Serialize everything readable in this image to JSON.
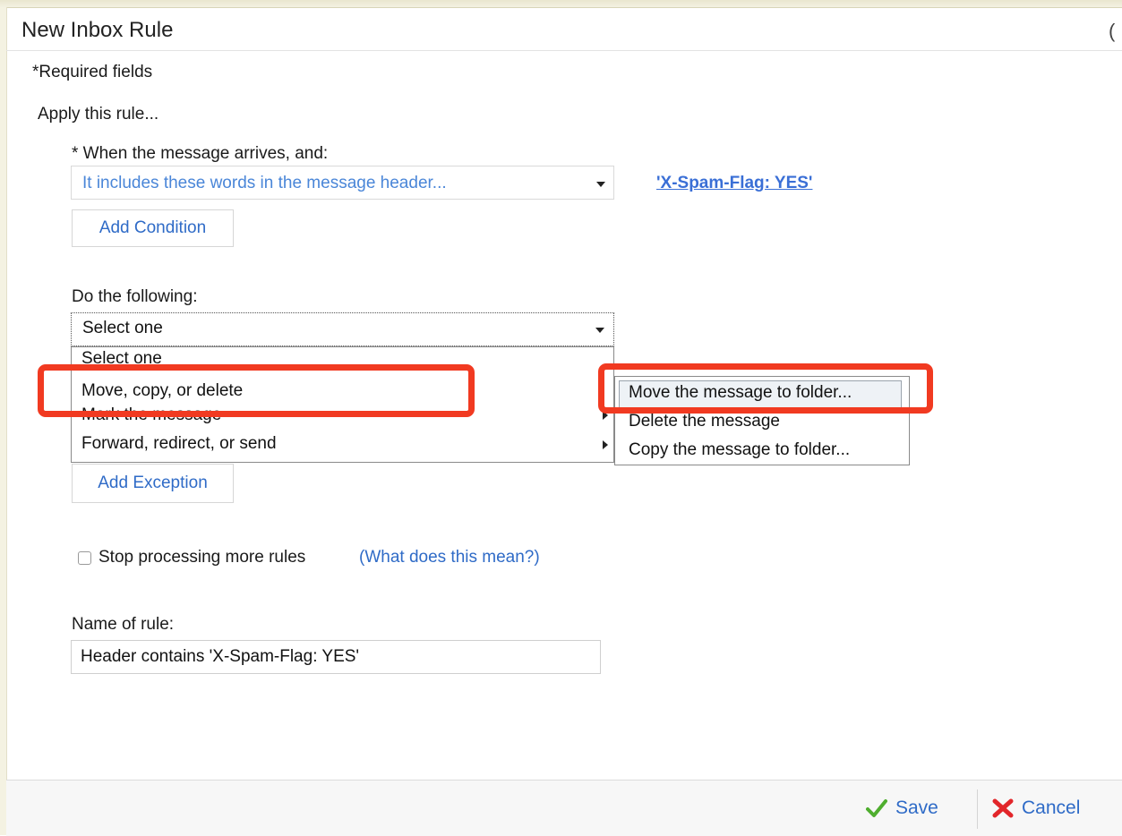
{
  "dialog": {
    "title": "New Inbox Rule",
    "title_edge": "(",
    "required_note": "*Required fields",
    "apply_label": "Apply this rule..."
  },
  "condition": {
    "label": "* When the message arrives, and:",
    "selected": "It includes these words in the message header...",
    "value_link": "'X-Spam-Flag: YES'",
    "add_button": "Add Condition"
  },
  "action": {
    "label": "Do the following:",
    "selected": "Select one",
    "options": [
      {
        "label": "Select one",
        "has_submenu": false,
        "highlighted": false
      },
      {
        "label": "Move, copy, or delete",
        "has_submenu": true,
        "highlighted": true
      },
      {
        "label": "Mark the message",
        "has_submenu": true,
        "highlighted": false
      },
      {
        "label": "Forward, redirect, or send",
        "has_submenu": true,
        "highlighted": false
      }
    ],
    "submenu": [
      {
        "label": "Move the message to folder...",
        "selected": true
      },
      {
        "label": "Delete the message",
        "selected": false
      },
      {
        "label": "Copy the message to folder...",
        "selected": false
      }
    ]
  },
  "exception": {
    "add_button": "Add Exception"
  },
  "stop_processing": {
    "checked": false,
    "label": "Stop processing more rules",
    "help_link": "(What does this mean?)"
  },
  "rule_name": {
    "label": "Name of rule:",
    "value": "Header contains 'X-Spam-Flag: YES'"
  },
  "footer": {
    "save_label": "Save",
    "cancel_label": "Cancel"
  },
  "colors": {
    "highlight_box": "#f13a21",
    "link": "#3a6fd6",
    "button_text": "#2f6bc7"
  },
  "icons": {
    "save": "checkmark-icon",
    "cancel": "x-icon",
    "dropdown": "caret-down-icon",
    "submenu": "caret-right-icon"
  }
}
